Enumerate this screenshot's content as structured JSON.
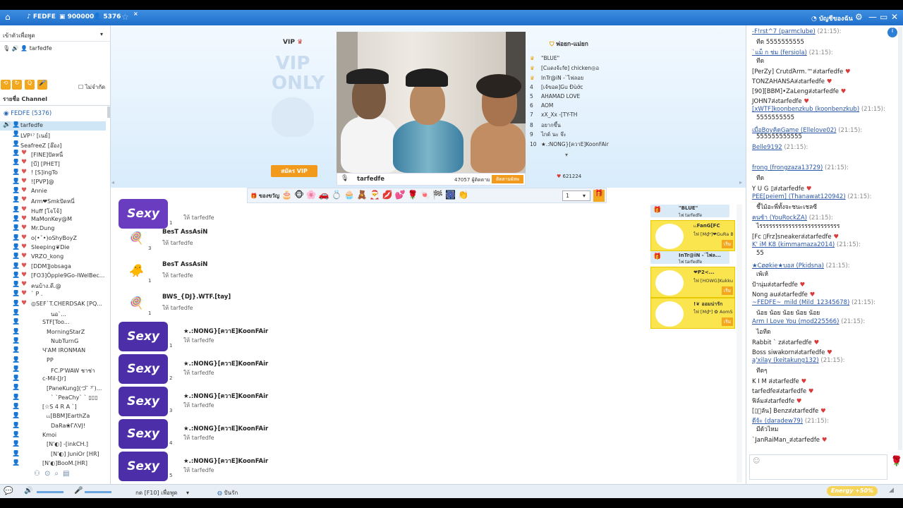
{
  "titlebar": {
    "room": "FEDFE",
    "coins": "900000",
    "members": "5376",
    "account": "บัญชีของฉัน"
  },
  "left": {
    "tabs_label": "เข้าตัวเพื่อพูด",
    "mic_user": "tarfedfe",
    "filter_label": "ไม่จำกัด",
    "channel_header": "รายชื่อ Channel",
    "channel_name": "FEDFE (5376)",
    "users": [
      "tarfedfe",
      "LVP¹⁷ [เนย์]",
      "SeafreeZ [อ๊อง]",
      "[FINE]ปัดหนี่",
      "[บี] [PHET]",
      "! [S]ingTo",
      "![PVP]@",
      "Annie",
      "Arm❤Smkปัดหนี่",
      "Huff [โจโจ้]",
      "MaMonKey@M",
      "Mr.Dung",
      "o(•ˇ•)oShyBoyZ",
      "Sleeping❦Die",
      "VRZO_kong",
      "[DDM]Jobsaga",
      "[FO3]Ôpple9Go-IWelBec...",
      "คนบ้าง.ดี.@",
      "` P .",
      "◎SEF`T.CHERDSAK [PQ...",
      "นอ`...",
      "STF[Too...",
      "MorningStarZ",
      "NubTurnG",
      "Ч'AM IRONMAN",
      "PP",
      "FC.P'WAW ชาช่า",
      "c-Mil-[Jr]",
      "[PaneKung](づ ̄ ³ ̄)...",
      "` `PeaChy` ` ▯▯▯",
      "[☆S 4 R A `]",
      "˪˪[BBM]EarthZa",
      "DaRa❀ΓΛVJ!",
      "Kmoi",
      "[N'◐] -[inkCH.]",
      "[N'◐] JuniOr [HR]",
      "[N'◐]BooM.[HR]"
    ]
  },
  "stage": {
    "vip_label": "VIP",
    "vip_only": "VIP ONLY",
    "vip_button": "สมัคร VIP",
    "host_name": "tarfedfe",
    "viewers": "47057 ผู้ติดตาม",
    "follow_button": "ติดตามผัลพ",
    "rank_title": "พ่อยก-แม่ยก",
    "ranks": [
      "\"BLUE\"",
      "[Cแดงจ้ะfe] chicken◎อ",
      "InTr@iN -`ไฟลอย",
      "[เจ้ขอด]Gu Đùớc",
      "AHAMAD LOVE",
      "AOM",
      "xX_Xx -[TY-TH",
      "อยากขึ้น",
      "ไกด์ นะ จ๊ะ",
      "★.:NONG}[ควาE]KoonFAir"
    ],
    "hearts": "621224"
  },
  "giftbar": {
    "label": "ของขวัญ",
    "qty": "1"
  },
  "feed": [
    {
      "who": "",
      "to": "ให้ tarfedfe",
      "n": "1"
    },
    {
      "who": "BesT AssAsiN",
      "to": "ให้ tarfedfe",
      "n": "3"
    },
    {
      "who": "BesT AssAsiN",
      "to": "ให้ tarfedfe",
      "n": "1"
    },
    {
      "who": "BWS_{DJ}.WTF.[tay]",
      "to": "ให้ tarfedfe",
      "n": "1"
    },
    {
      "who": "★.:NONG}[ควาE]KoonFAir",
      "to": "ให้ tarfedfe",
      "n": "1"
    },
    {
      "who": "★.:NONG}[ควาE]KoonFAir",
      "to": "ให้ tarfedfe",
      "n": "2"
    },
    {
      "who": "★.:NONG}[ควาE]KoonFAir",
      "to": "ให้ tarfedfe",
      "n": "3"
    },
    {
      "who": "★.:NONG}[ควาE]KoonFAir",
      "to": "ให้ tarfedfe",
      "n": "4"
    },
    {
      "who": "★.:NONG}[ควาE]KoonFAir",
      "to": "ให้ tarfedfe",
      "n": "5"
    }
  ],
  "cards": [
    {
      "name": "\"BLUE\"",
      "sub": "ไฟ tarfedfe"
    },
    {
      "name": "˪˪FanG[FC",
      "sub": "ไฟ [M₫ᵃ]❤GuRa B..."
    },
    {
      "name": "InTr@iN -`ไฟล...",
      "sub": "ไฟ tarfedfe"
    },
    {
      "name": "❤P2<...",
      "sub": "ไฟ [HOWG]KukkuiZ"
    },
    {
      "name": "!❦ ออมน่ารัก",
      "sub": "ไฟ [M₫ᵃ] ✿ AomSi..."
    }
  ],
  "card_button": "เริ่ม",
  "chat": [
    {
      "u": "-F!rst^7 (parmclube)",
      "t": "(21:15):",
      "m": "ทีด 5555555555"
    },
    {
      "u": "`แม็ ก ช่ม (fersiola)",
      "t": "(21:15):",
      "m": "ทีด"
    },
    {
      "u": "",
      "t": "",
      "m": "[PerZy] CrutdΆrm.™ส่งtarfedfe"
    },
    {
      "u": "",
      "t": "",
      "m": "TONZAHANSAส่งtarfedfe"
    },
    {
      "u": "",
      "t": "",
      "m": "[90][BBM]•ZaLengส่งtarfedfe"
    },
    {
      "u": "",
      "t": "",
      "m": "JOHN7ส่งtarfedfe"
    },
    {
      "u": "[xWTF]koonbenzkub (koonbenzkub)",
      "t": "(21:15):",
      "m": "5555555555"
    },
    {
      "u": "เมื่อBoyคิดGame (Ellelove02)",
      "t": "(21:15):",
      "m": "555555555555"
    },
    {
      "u": "Belle9192",
      "t": "(21:15):",
      "m": ""
    },
    {
      "u": "frong (frongzaza13729)",
      "t": "(21:15):",
      "m": "ทีด"
    },
    {
      "u": "",
      "t": "",
      "m": "Y U G ▯ส่งtarfedfe"
    },
    {
      "u": "PEE[peiem] (Thanawat120942)",
      "t": "(21:15):",
      "m": "ชี้ไม้อะพี่ทั้งจะชนะเชลซี"
    },
    {
      "u": "คนซ้า (YouRockZA)",
      "t": "(21:15):",
      "m": "ไรรรรรรรรรรรรรรรรรรรรรรรรร"
    },
    {
      "u": "",
      "t": "",
      "m": "[Fc ▯Frz]sneakerส่งtarfedfe"
    },
    {
      "u": "K' iM K8 (kimmamaza2014)",
      "t": "(21:15):",
      "m": "55"
    },
    {
      "u": "★Cøøkie★บอส (Pkidsna)",
      "t": "(21:15):",
      "m": "เพ้เห้"
    },
    {
      "u": "",
      "t": "",
      "m": "ป้านุ่มส่งtarfedfe"
    },
    {
      "u": "",
      "t": "",
      "m": "Nong auส่งtarfedfe"
    },
    {
      "u": "~FEDFE~_mild (Mild_12345678)",
      "t": "(21:15):",
      "m": "น้อย น้อย น้อย น้อย น้อย"
    },
    {
      "u": "Arm I Love You (mod225566)",
      "t": "(21:15):",
      "m": "ไอทีด"
    },
    {
      "u": "",
      "t": "",
      "m": "Rabbit ` zส่งtarfedfe"
    },
    {
      "u": "",
      "t": "",
      "m": "Boss siwakornส่งtarfedfe"
    },
    {
      "u": "ą'xilay (keitakung132)",
      "t": "(21:15):",
      "m": "ทีดๆ"
    },
    {
      "u": "",
      "t": "",
      "m": "K I M ส่งtarfedfe"
    },
    {
      "u": "",
      "t": "",
      "m": "tarfedfeส่งtarfedfe"
    },
    {
      "u": "",
      "t": "",
      "m": "ฟิล์มส่งtarfedfe"
    },
    {
      "u": "",
      "t": "",
      "m": "[▯ิลัน] Benzส่งtarfedfe"
    },
    {
      "u": "ดีจ้ะ (daradew79)",
      "t": "(21:15):",
      "m": "มีด้วไหม"
    },
    {
      "u": "",
      "t": "",
      "m": "`JanRaiMan_ส่งtarfedfe"
    }
  ],
  "bottom": {
    "hint": "กด [F10] เพื่อพูด",
    "invite": "ปันรัก",
    "energy": "Energy +50%"
  },
  "colors": {
    "accent": "#1f6fcb",
    "gift_card": "#fbe54e",
    "heart": "#d93a3a"
  }
}
